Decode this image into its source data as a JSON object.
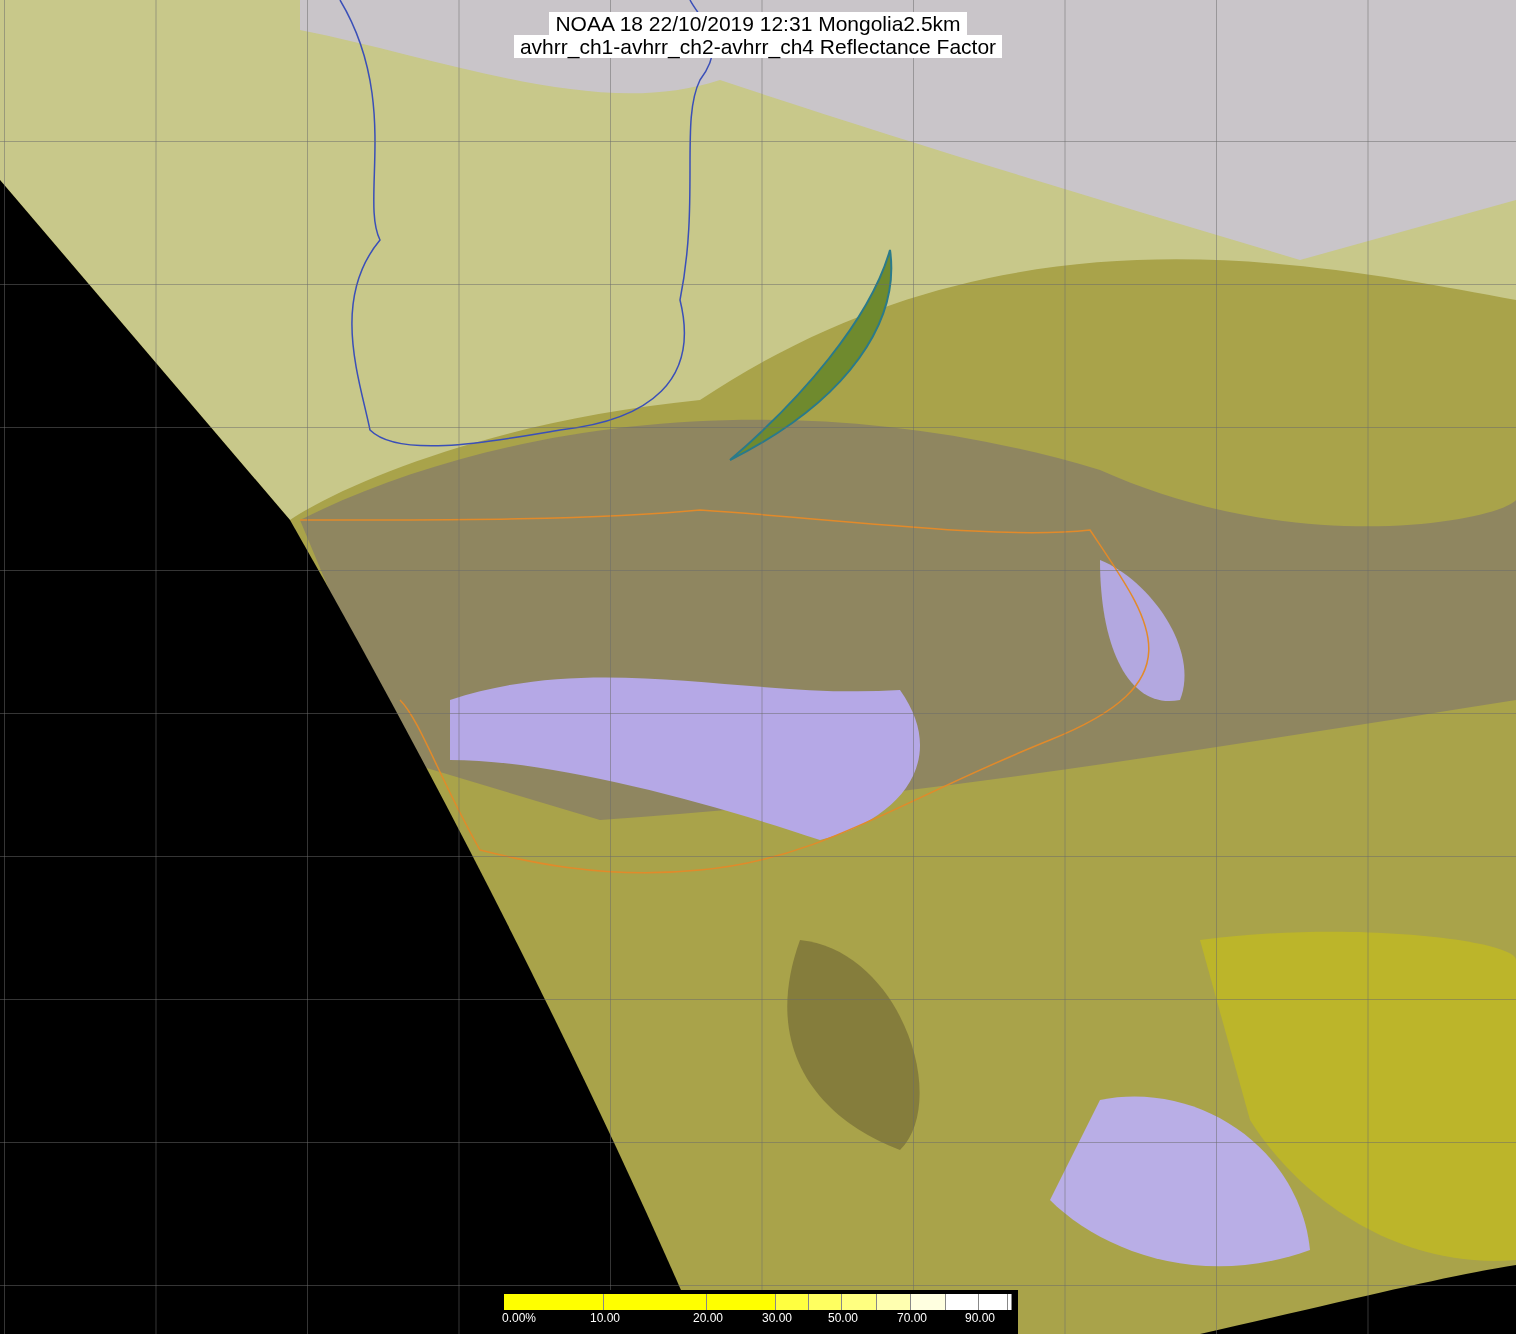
{
  "map": {
    "title_lines": [
      "NOAA 18 22/10/2019 12:31 Mongolia2.5km",
      "avhrr_ch1-avhrr_ch2-avhrr_ch4 Reflectance Factor"
    ]
  },
  "colorbar": {
    "labels": [
      "0.00%",
      "10.00",
      "20.00",
      "30.00",
      "50.00",
      "70.00",
      "90.00"
    ]
  }
}
